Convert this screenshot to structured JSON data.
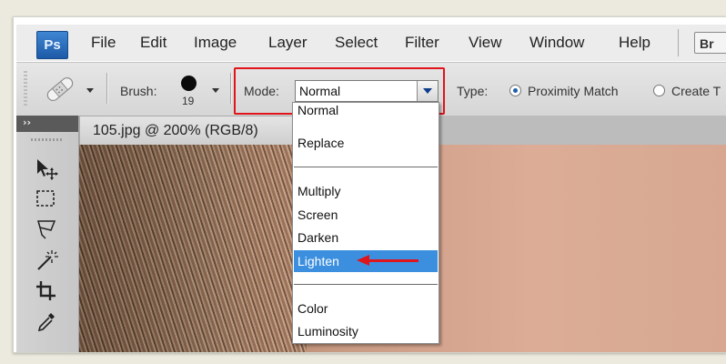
{
  "app": {
    "logo_text": "Ps"
  },
  "menu": {
    "items": [
      "File",
      "Edit",
      "Image",
      "Layer",
      "Select",
      "Filter",
      "View",
      "Window",
      "Help"
    ],
    "overflow_label": "Br"
  },
  "options_bar": {
    "brush_label": "Brush:",
    "brush_size": "19",
    "mode_label": "Mode:",
    "mode_value": "Normal",
    "type_label": "Type:",
    "type_options": [
      "Proximity Match",
      "Create T"
    ],
    "type_selected": "Proximity Match"
  },
  "document": {
    "tab_title": "105.jpg @ 200% (RGB/8)",
    "tab_close": "×"
  },
  "mode_dropdown": {
    "groups": [
      [
        "Normal",
        "Replace"
      ],
      [
        "Multiply",
        "Screen",
        "Darken",
        "Lighten"
      ],
      [
        "Color",
        "Luminosity"
      ]
    ],
    "highlighted": "Lighten"
  },
  "toolbox": {
    "collapse_glyph": "››",
    "tools": [
      "move-tool-icon",
      "marquee-tool-icon",
      "lasso-tool-icon",
      "magic-wand-tool-icon",
      "crop-tool-icon",
      "eyedropper-tool-icon"
    ]
  },
  "colors": {
    "highlight": "#e0141b",
    "selection": "#3c8fde",
    "ps_blue": "#1d5aa8"
  }
}
